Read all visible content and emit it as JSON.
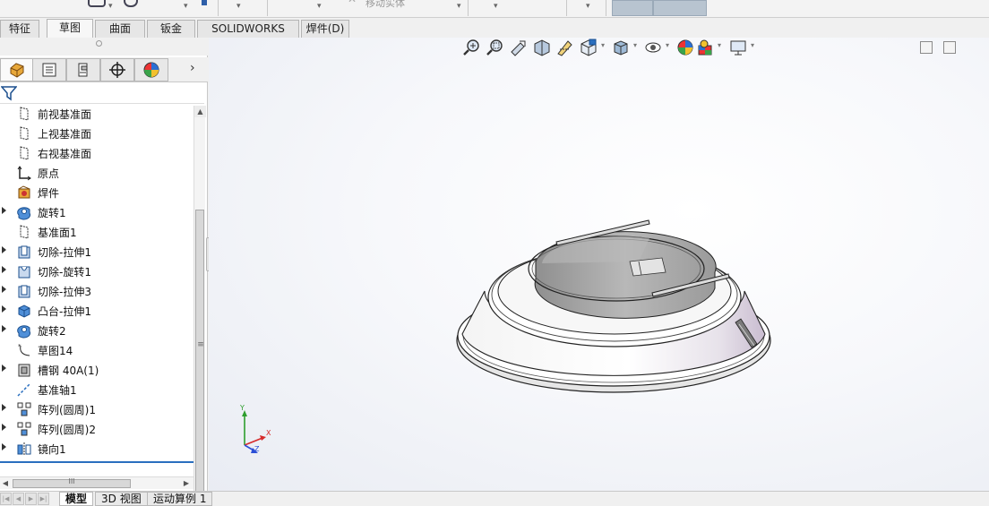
{
  "command_strip": {
    "move_body_label": "移动实体"
  },
  "tabs": [
    {
      "label": "特征"
    },
    {
      "label": "草图"
    },
    {
      "label": "曲面"
    },
    {
      "label": "钣金"
    },
    {
      "label": "SOLIDWORKS MBD"
    },
    {
      "label": "焊件(D)"
    }
  ],
  "active_tab": "草图",
  "panel_tabs": [
    {
      "icon": "feature-manager-icon"
    },
    {
      "icon": "property-manager-icon"
    },
    {
      "icon": "configuration-manager-icon"
    },
    {
      "icon": "dimxpert-icon"
    },
    {
      "icon": "display-manager-icon"
    }
  ],
  "tree": {
    "items": [
      {
        "label": "前视基准面",
        "icon": "plane-icon",
        "expandable": false
      },
      {
        "label": "上视基准面",
        "icon": "plane-icon",
        "expandable": false
      },
      {
        "label": "右视基准面",
        "icon": "plane-icon",
        "expandable": false
      },
      {
        "label": "原点",
        "icon": "origin-icon",
        "expandable": false
      },
      {
        "label": "焊件",
        "icon": "weldment-icon",
        "expandable": false
      },
      {
        "label": "旋转1",
        "icon": "revolve-icon",
        "expandable": true
      },
      {
        "label": "基准面1",
        "icon": "plane-icon",
        "expandable": false
      },
      {
        "label": "切除-拉伸1",
        "icon": "cut-extrude-icon",
        "expandable": true
      },
      {
        "label": "切除-旋转1",
        "icon": "cut-revolve-icon",
        "expandable": true
      },
      {
        "label": "切除-拉伸3",
        "icon": "cut-extrude-icon",
        "expandable": true
      },
      {
        "label": "凸台-拉伸1",
        "icon": "boss-extrude-icon",
        "expandable": true
      },
      {
        "label": "旋转2",
        "icon": "revolve-icon",
        "expandable": true
      },
      {
        "label": "草图14",
        "icon": "sketch-icon",
        "expandable": false
      },
      {
        "label": "槽钢 40A(1)",
        "icon": "structural-member-icon",
        "expandable": true
      },
      {
        "label": "基准轴1",
        "icon": "axis-icon",
        "expandable": false
      },
      {
        "label": "阵列(圆周)1",
        "icon": "circular-pattern-icon",
        "expandable": true
      },
      {
        "label": "阵列(圆周)2",
        "icon": "circular-pattern-icon",
        "expandable": true
      },
      {
        "label": "镜向1",
        "icon": "mirror-icon",
        "expandable": true
      }
    ]
  },
  "triad": {
    "x": "X",
    "y": "Y",
    "z": "Z"
  },
  "bottom_tabs": [
    {
      "label": "模型"
    },
    {
      "label": "3D 视图"
    },
    {
      "label": "运动算例 1"
    }
  ],
  "hscroll_marker": "III",
  "vscroll_marker": "≡",
  "colors": {
    "accent_blue": "#2a6fbf",
    "model_outline": "#1a1a1a",
    "viewport_bg": "#eef0f5"
  }
}
